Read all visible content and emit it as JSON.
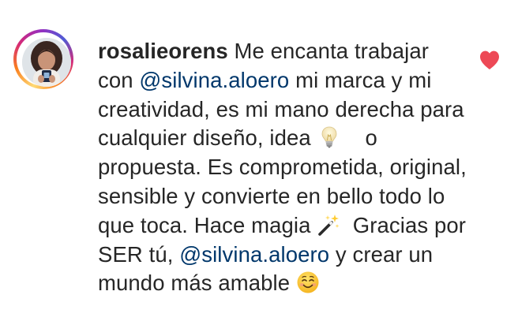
{
  "comment": {
    "username": "rosalieorens",
    "seg1": "Me encanta trabajar con",
    "mention1": "@silvina.aloero",
    "seg2": "mi marca y mi creatividad, es mi mano derecha para cualquier diseño, idea",
    "emoji1": "light-bulb",
    "seg3": "o propuesta. Es comprometida, original, sensible y convierte en bello todo lo que toca. Hace magia",
    "emoji2": "magic-wand",
    "seg4": "Gracias por SER tú,",
    "mention2": "@silvina.aloero",
    "seg5": "y crear un mundo más amable",
    "emoji3": "smiling-face",
    "liked": true
  },
  "colors": {
    "text": "#262626",
    "mention": "#00376b",
    "like": "#ed4956"
  }
}
